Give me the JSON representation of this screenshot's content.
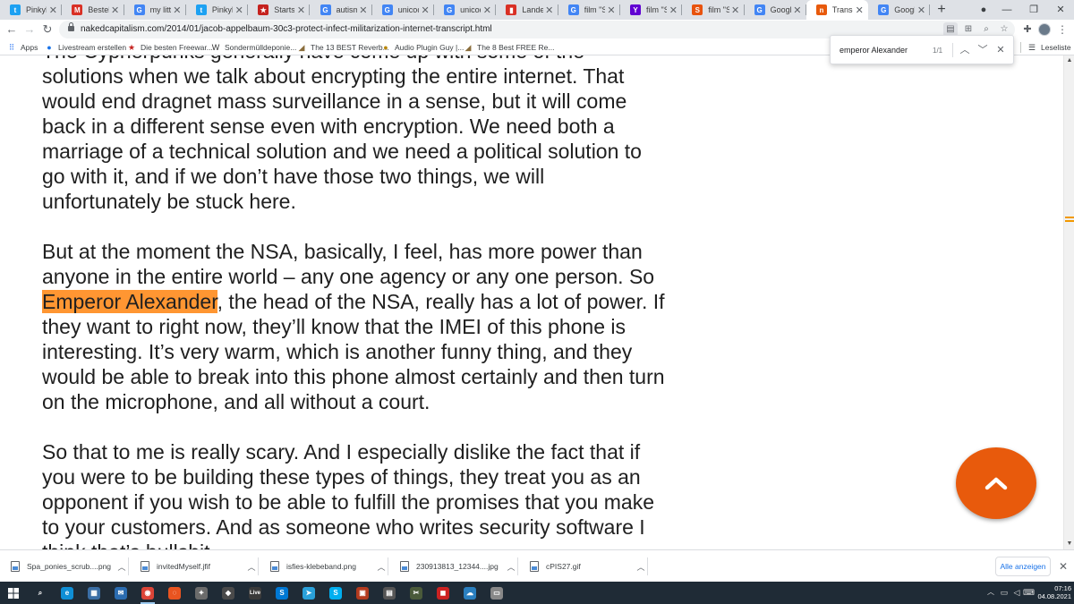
{
  "browser": {
    "tabs": [
      {
        "title": "PinkyDe",
        "favicon": "twitter-icon",
        "color": "#1da1f2",
        "glyph": "t"
      },
      {
        "title": "Bestellu",
        "favicon": "mail-icon",
        "color": "#d93025",
        "glyph": "M"
      },
      {
        "title": "my little",
        "favicon": "google-icon",
        "color": "#4285f4",
        "glyph": "G"
      },
      {
        "title": "PinkyDe",
        "favicon": "twitter-icon",
        "color": "#1da1f2",
        "glyph": "t"
      },
      {
        "title": "Startseit",
        "favicon": "star-icon",
        "color": "#c5221f",
        "glyph": "★"
      },
      {
        "title": "autism s",
        "favicon": "google-icon",
        "color": "#4285f4",
        "glyph": "G"
      },
      {
        "title": "unicode",
        "favicon": "google-icon",
        "color": "#4285f4",
        "glyph": "G"
      },
      {
        "title": "unicode",
        "favicon": "google-icon",
        "color": "#4285f4",
        "glyph": "G"
      },
      {
        "title": "Landev",
        "favicon": "document-icon",
        "color": "#d93025",
        "glyph": "▮"
      },
      {
        "title": "film \"Sta",
        "favicon": "google-icon",
        "color": "#4285f4",
        "glyph": "G"
      },
      {
        "title": "film \"Ste",
        "favicon": "yahoo-icon",
        "color": "#6001d2",
        "glyph": "Y"
      },
      {
        "title": "film \"Sta",
        "favicon": "startpage-icon",
        "color": "#e8530e",
        "glyph": "S"
      },
      {
        "title": "Google",
        "favicon": "google-translate-icon",
        "color": "#4285f4",
        "glyph": "G"
      },
      {
        "title": "Transcri",
        "favicon": "naked-capitalism-icon",
        "color": "#e85a0c",
        "glyph": "n"
      },
      {
        "title": "Google",
        "favicon": "google-translate-icon",
        "color": "#4285f4",
        "glyph": "G"
      }
    ],
    "active_tab": 13,
    "url": "nakedcapitalism.com/2014/01/jacob-appelbaum-30c3-protect-infect-militarization-internet-transcript.html",
    "bookmarks": [
      {
        "label": "Apps",
        "icon": "apps-grid-icon",
        "glyph": "⠿",
        "color": "#4285f4"
      },
      {
        "label": "Livestream erstellen",
        "icon": "livestream-icon",
        "glyph": "●",
        "color": "#1a73e8"
      },
      {
        "label": "Die besten Freewar...",
        "icon": "star-icon",
        "glyph": "★",
        "color": "#c5221f"
      },
      {
        "label": "Sondermülldeponie...",
        "icon": "wikipedia-icon",
        "glyph": "W",
        "color": "#333333"
      },
      {
        "label": "The 13 BEST Reverb...",
        "icon": "ruler-icon",
        "glyph": "◢",
        "color": "#8a6d3b"
      },
      {
        "label": "Audio Plugin Guy |...",
        "icon": "audio-plugin-icon",
        "glyph": "●",
        "color": "#b8860b"
      },
      {
        "label": "The 8 Best FREE Re...",
        "icon": "ruler-icon",
        "glyph": "◢",
        "color": "#8a6d3b"
      }
    ],
    "reading_list": "Leseliste"
  },
  "find_bar": {
    "query": "emperor Alexander",
    "count": "1/1"
  },
  "article": {
    "top_partial": "The Cypherpunks generally have come up with some of the",
    "p1_rest": "solutions when we talk about encrypting the entire internet. That would end dragnet mass surveillance in a sense, but it will come back in a different sense even with encryption. We need both a marriage of a technical solution and we need a political solution to go with it, and if we don’t have those two things, we will unfortunately be stuck here.",
    "p2_before": "But at the moment the NSA, basically, I feel, has more power than anyone in the entire world – any one agency or any one person. So ",
    "p2_highlight": "Emperor Alexander",
    "p2_after": ", the head of the NSA, really has a lot of power. If they want to right now, they’ll know that the IMEI of this phone is interesting. It’s very warm, which is another funny thing, and they would be able to break into this phone almost certainly and then turn on the microphone, and all without a court.",
    "p3": "So that to me is really scary. And I especially dislike the fact that if you were to be building these types of things, they treat you as an opponent if you wish to be able to fulfill the promises that you make to your customers. And as someone who writes security software I think that’s bullshit."
  },
  "downloads": {
    "items": [
      "Spa_ponies_scrub....png",
      "invitedMyself.jfif",
      "isfies-klebeband.png",
      "230913813_12344....jpg",
      "cPIS27.gif"
    ],
    "show_all": "Alle anzeigen"
  },
  "taskbar": {
    "apps": [
      {
        "icon": "search-icon",
        "glyph": "⌕",
        "color": "transparent"
      },
      {
        "icon": "edge-icon",
        "glyph": "e",
        "color": "#0f8fd6"
      },
      {
        "icon": "store-icon",
        "glyph": "▦",
        "color": "#3a6ea5"
      },
      {
        "icon": "mail-icon",
        "glyph": "✉",
        "color": "#2b6cb0"
      },
      {
        "icon": "chrome-icon",
        "glyph": "◉",
        "color": "#db4437"
      },
      {
        "icon": "ubuntu-icon",
        "glyph": "◌",
        "color": "#e95420"
      },
      {
        "icon": "tool-icon",
        "glyph": "✦",
        "color": "#6b6b6b"
      },
      {
        "icon": "inkscape-icon",
        "glyph": "◆",
        "color": "#4a4a4a"
      },
      {
        "icon": "live-icon",
        "glyph": "Live",
        "color": "#3a3a3a"
      },
      {
        "icon": "skype-icon",
        "glyph": "S",
        "color": "#0078d4"
      },
      {
        "icon": "telegram-icon",
        "glyph": "➤",
        "color": "#2aa1da"
      },
      {
        "icon": "skype-alt-icon",
        "glyph": "S",
        "color": "#00aff0"
      },
      {
        "icon": "game-icon",
        "glyph": "▣",
        "color": "#b33a1e"
      },
      {
        "icon": "app-icon",
        "glyph": "▤",
        "color": "#555555"
      },
      {
        "icon": "scissors-icon",
        "glyph": "✂",
        "color": "#4a5a3a"
      },
      {
        "icon": "stream-icon",
        "glyph": "◼",
        "color": "#c22"
      },
      {
        "icon": "cloud-icon",
        "glyph": "☁",
        "color": "#2a7fbf"
      },
      {
        "icon": "window-icon",
        "glyph": "▭",
        "color": "#888888"
      }
    ],
    "time": "07:16",
    "date": "04.08.2021"
  }
}
